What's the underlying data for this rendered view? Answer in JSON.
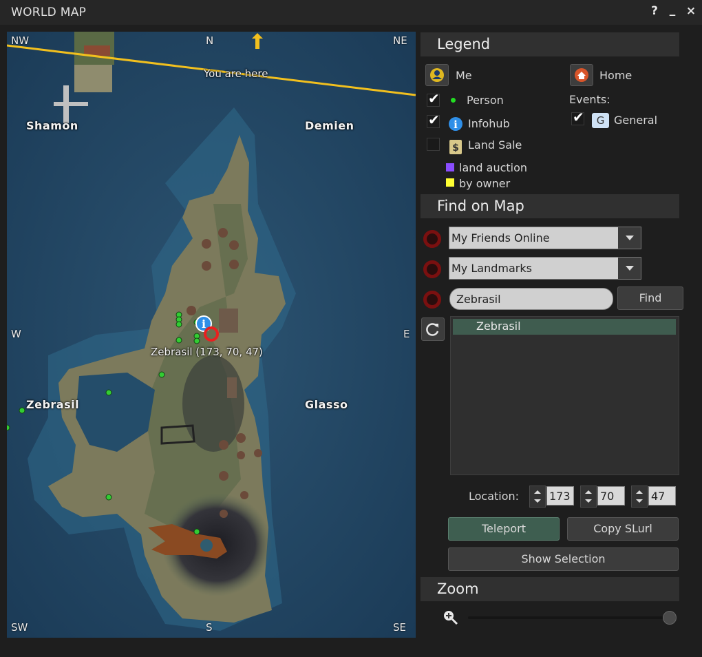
{
  "window": {
    "title": "WORLD MAP",
    "help": "?",
    "minimize": "_",
    "close": "×"
  },
  "map": {
    "compass": {
      "nw": "NW",
      "n": "N",
      "ne": "NE",
      "w": "W",
      "e": "E",
      "sw": "SW",
      "s": "S",
      "se": "SE"
    },
    "you_are_here": "You are here",
    "regions": {
      "shamon": "Shamon",
      "demien": "Demien",
      "zebrasil": "Zebrasil",
      "glasso": "Glasso"
    },
    "target_label": "Zebrasil (173, 70, 47)"
  },
  "legend": {
    "title": "Legend",
    "me": "Me",
    "home": "Home",
    "person": "Person",
    "infohub": "Infohub",
    "land_sale": "Land Sale",
    "land_auction": "land auction",
    "by_owner": "by owner",
    "events": "Events:",
    "general": "General",
    "general_icon": "G",
    "person_checked": true,
    "infohub_checked": true,
    "land_sale_checked": false,
    "general_checked": true,
    "colors": {
      "land_auction": "#8a4dff",
      "by_owner": "#ffff33",
      "person": "#22dd22"
    }
  },
  "find": {
    "title": "Find on Map",
    "friends": "My Friends Online",
    "landmarks": "My Landmarks",
    "search_value": "Zebrasil",
    "find_button": "Find",
    "results": [
      "Zebrasil"
    ]
  },
  "location": {
    "label": "Location:",
    "x": "173",
    "y": "70",
    "z": "47"
  },
  "actions": {
    "teleport": "Teleport",
    "copy_slurl": "Copy SLurl",
    "show_selection": "Show Selection"
  },
  "zoom": {
    "title": "Zoom",
    "level": 1.0
  }
}
